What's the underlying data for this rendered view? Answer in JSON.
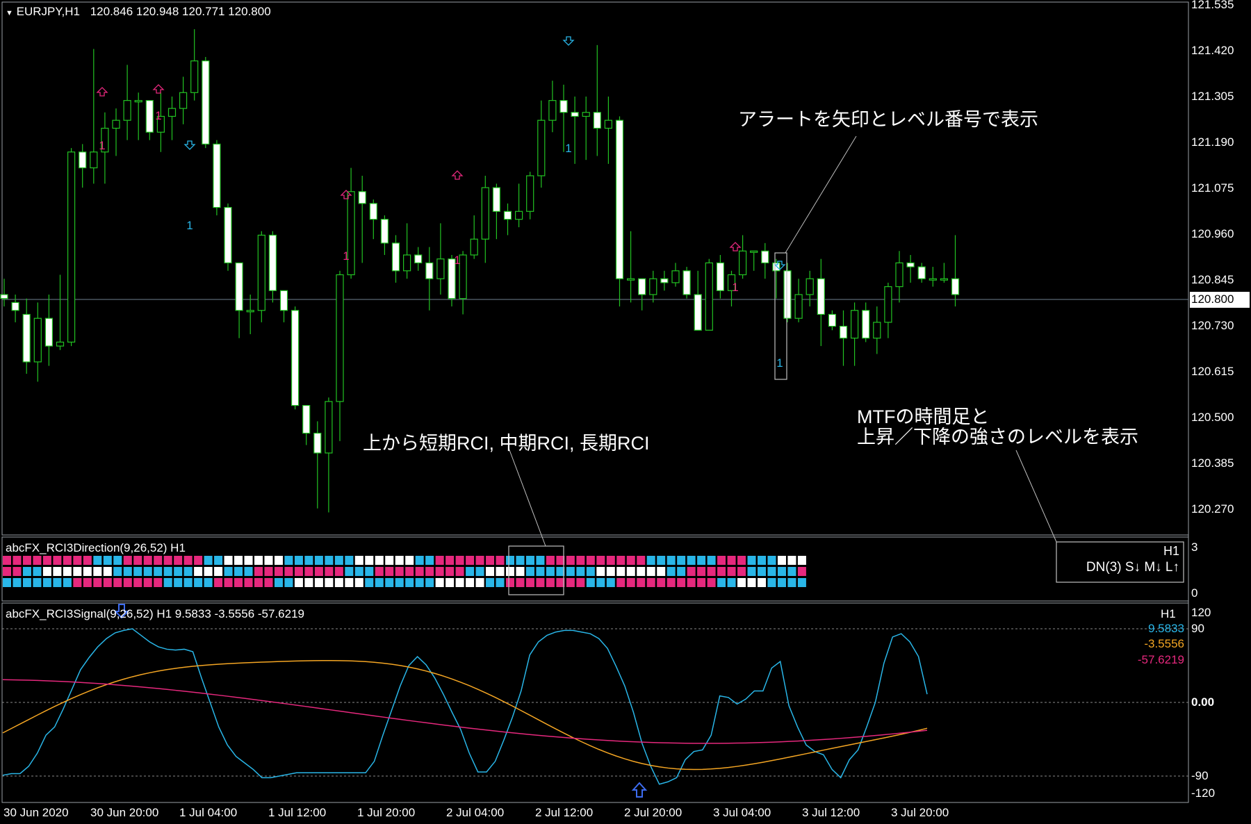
{
  "main": {
    "symbol": "EURJPY,H1",
    "ohlc": "120.846 120.948 120.771 120.800",
    "current_price": "120.800",
    "price_axis": [
      "121.535",
      "121.420",
      "121.305",
      "121.190",
      "121.075",
      "120.960",
      "120.845",
      "120.730",
      "120.615",
      "120.500",
      "120.385",
      "120.270"
    ]
  },
  "annotations": {
    "alert": "アラートを矢印とレベル番号で表示",
    "rci_order": "上から短期RCI, 中期RCI, 長期RCI",
    "mtf_line1": "MTFの時間足と",
    "mtf_line2": "上昇／下降の強さのレベルを表示"
  },
  "direction": {
    "title": "abcFX_RCI3Direction(9,26,52) H1",
    "axis_top": "3",
    "axis_bottom": "0",
    "mtf_tf": "H1",
    "mtf_status": "DN(3) S↓ M↓ L↑"
  },
  "signal": {
    "title": "abcFX_RCI3Signal(9,26,52) H1 9.5833 -3.5556 -57.6219",
    "tf": "H1",
    "short_value": "9.5833",
    "mid_value": "-3.5556",
    "long_value": "-57.6219",
    "axis": [
      "120",
      "90",
      "0.00",
      "-90",
      "-120"
    ],
    "short_color": "#29b6e8",
    "mid_color": "#f5a623",
    "long_color": "#e6287d"
  },
  "time_axis": [
    "30 Jun 2020",
    "30 Jun 20:00",
    "1 Jul 04:00",
    "1 Jul 12:00",
    "1 Jul 20:00",
    "2 Jul 04:00",
    "2 Jul 12:00",
    "2 Jul 20:00",
    "3 Jul 04:00",
    "3 Jul 12:00",
    "3 Jul 20:00"
  ],
  "marker_labels": [
    "1",
    "1",
    "1",
    "1",
    "1",
    "1",
    "1",
    "1"
  ],
  "chart_data": {
    "type": "candlestick",
    "ylim": [
      120.2,
      121.535
    ],
    "candles": [
      [
        120.8,
        120.79,
        120.84,
        120.77
      ],
      [
        120.78,
        120.76,
        120.8,
        120.73
      ],
      [
        120.75,
        120.63,
        120.79,
        120.6
      ],
      [
        120.63,
        120.74,
        120.78,
        120.58
      ],
      [
        120.74,
        120.67,
        120.8,
        120.62
      ],
      [
        120.67,
        120.68,
        120.85,
        120.66
      ],
      [
        120.68,
        121.16,
        121.17,
        120.67
      ],
      [
        121.16,
        121.12,
        121.18,
        121.07
      ],
      [
        121.12,
        121.16,
        121.42,
        121.08
      ],
      [
        121.16,
        121.22,
        121.26,
        121.08
      ],
      [
        121.22,
        121.24,
        121.27,
        121.15
      ],
      [
        121.24,
        121.29,
        121.38,
        121.19
      ],
      [
        121.29,
        121.29,
        121.31,
        121.19
      ],
      [
        121.29,
        121.21,
        121.29,
        121.19
      ],
      [
        121.21,
        121.25,
        121.31,
        121.16
      ],
      [
        121.25,
        121.27,
        121.3,
        121.19
      ],
      [
        121.27,
        121.31,
        121.35,
        121.23
      ],
      [
        121.31,
        121.39,
        121.47,
        121.29
      ],
      [
        121.39,
        121.18,
        121.4,
        121.17
      ],
      [
        121.18,
        121.02,
        121.19,
        121.0
      ],
      [
        121.02,
        120.88,
        121.03,
        120.86
      ],
      [
        120.88,
        120.76,
        120.88,
        120.69
      ],
      [
        120.76,
        120.76,
        120.8,
        120.7
      ],
      [
        120.76,
        120.95,
        120.96,
        120.73
      ],
      [
        120.95,
        120.81,
        120.96,
        120.78
      ],
      [
        120.81,
        120.76,
        120.81,
        120.73
      ],
      [
        120.76,
        120.52,
        120.77,
        120.51
      ],
      [
        120.52,
        120.45,
        120.52,
        120.42
      ],
      [
        120.45,
        120.4,
        120.48,
        120.26
      ],
      [
        120.4,
        120.53,
        120.54,
        120.25
      ],
      [
        120.53,
        120.85,
        120.86,
        120.43
      ],
      [
        120.85,
        121.06,
        121.12,
        120.84
      ],
      [
        121.06,
        121.03,
        121.1,
        120.88
      ],
      [
        121.03,
        120.99,
        121.04,
        120.94
      ],
      [
        120.99,
        120.93,
        121.0,
        120.9
      ],
      [
        120.93,
        120.86,
        120.95,
        120.83
      ],
      [
        120.86,
        120.9,
        120.98,
        120.84
      ],
      [
        120.9,
        120.88,
        120.92,
        120.86
      ],
      [
        120.88,
        120.84,
        120.92,
        120.76
      ],
      [
        120.84,
        120.89,
        120.98,
        120.8
      ],
      [
        120.89,
        120.79,
        120.9,
        120.77
      ],
      [
        120.79,
        120.9,
        120.91,
        120.75
      ],
      [
        120.9,
        120.94,
        121.0,
        120.89
      ],
      [
        120.94,
        121.07,
        121.1,
        120.88
      ],
      [
        121.07,
        121.01,
        121.08,
        120.94
      ],
      [
        121.01,
        120.99,
        121.03,
        120.95
      ],
      [
        120.99,
        121.01,
        121.08,
        120.97
      ],
      [
        121.01,
        121.1,
        121.11,
        120.99
      ],
      [
        121.1,
        121.24,
        121.29,
        121.07
      ],
      [
        121.24,
        121.29,
        121.34,
        121.21
      ],
      [
        121.29,
        121.26,
        121.33,
        121.16
      ],
      [
        121.26,
        121.25,
        121.3,
        121.13
      ],
      [
        121.25,
        121.26,
        121.3,
        121.14
      ],
      [
        121.26,
        121.22,
        121.43,
        121.15
      ],
      [
        121.22,
        121.24,
        121.3,
        121.13
      ],
      [
        121.24,
        120.84,
        121.25,
        120.77
      ],
      [
        120.84,
        120.84,
        120.96,
        120.78
      ],
      [
        120.84,
        120.8,
        120.84,
        120.76
      ],
      [
        120.8,
        120.84,
        120.86,
        120.78
      ],
      [
        120.84,
        120.83,
        120.86,
        120.81
      ],
      [
        120.83,
        120.86,
        120.88,
        120.82
      ],
      [
        120.86,
        120.8,
        120.87,
        120.79
      ],
      [
        120.8,
        120.71,
        120.86,
        120.71
      ],
      [
        120.71,
        120.88,
        120.89,
        120.79
      ],
      [
        120.88,
        120.81,
        120.9,
        120.79
      ],
      [
        120.81,
        120.85,
        120.86,
        120.77
      ],
      [
        120.85,
        120.91,
        120.95,
        120.84
      ],
      [
        120.91,
        120.91,
        120.91,
        120.86
      ],
      [
        120.91,
        120.88,
        120.93,
        120.84
      ],
      [
        120.88,
        120.86,
        120.89,
        120.79
      ],
      [
        120.86,
        120.74,
        120.88,
        120.73
      ],
      [
        120.74,
        120.8,
        120.84,
        120.73
      ],
      [
        120.8,
        120.84,
        120.86,
        120.77
      ],
      [
        120.84,
        120.75,
        120.89,
        120.67
      ],
      [
        120.75,
        120.72,
        120.76,
        120.71
      ],
      [
        120.72,
        120.69,
        120.76,
        120.62
      ],
      [
        120.69,
        120.76,
        120.78,
        120.62
      ],
      [
        120.76,
        120.69,
        120.78,
        120.68
      ],
      [
        120.69,
        120.73,
        120.77,
        120.65
      ],
      [
        120.73,
        120.82,
        120.83,
        120.69
      ],
      [
        120.82,
        120.88,
        120.91,
        120.78
      ],
      [
        120.88,
        120.87,
        120.9,
        120.83
      ],
      [
        120.87,
        120.84,
        120.88,
        120.83
      ],
      [
        120.84,
        120.84,
        120.87,
        120.82
      ],
      [
        120.84,
        120.84,
        120.88,
        120.83
      ],
      [
        120.84,
        120.8,
        120.95,
        120.77
      ]
    ],
    "rci_short": [
      -89,
      -87,
      -87,
      -78,
      -62,
      -40,
      -30,
      -8,
      16,
      40,
      55,
      68,
      78,
      85,
      88,
      90,
      82,
      74,
      68,
      65,
      64,
      65,
      62,
      30,
      0,
      -30,
      -52,
      -66,
      -74,
      -82,
      -92,
      -92,
      -90,
      -88,
      -86,
      -86,
      -86,
      -86,
      -86,
      -86,
      -86,
      -86,
      -86,
      -72,
      -40,
      -10,
      20,
      45,
      56,
      46,
      30,
      10,
      -12,
      -33,
      -62,
      -85,
      -85,
      -72,
      -46,
      -18,
      14,
      58,
      74,
      82,
      86,
      88,
      88,
      86,
      84,
      78,
      66,
      44,
      20,
      -12,
      -50,
      -78,
      -100,
      -97,
      -92,
      -70,
      -60,
      -58,
      -40,
      8,
      6,
      -2,
      4,
      14,
      14,
      42,
      50,
      -4,
      -30,
      -52,
      -60,
      -64,
      -82,
      -92,
      -70,
      -58,
      -30,
      0,
      48,
      80,
      84,
      74,
      56,
      10
    ]
  }
}
